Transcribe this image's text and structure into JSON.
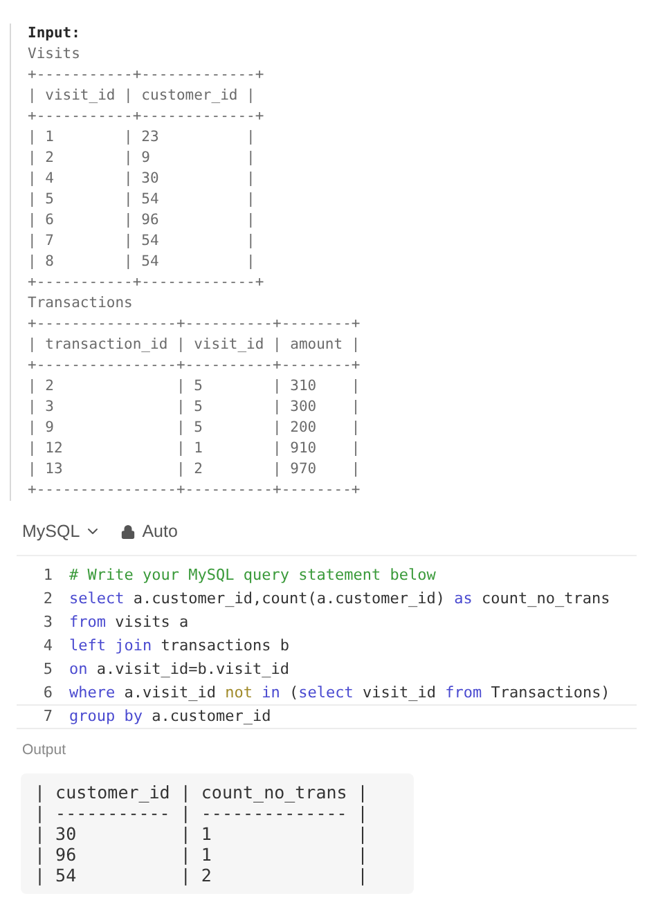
{
  "input_block": {
    "lines": [
      {
        "kind": "label",
        "text": "Input:"
      },
      {
        "kind": "text",
        "text": "Visits"
      },
      {
        "kind": "text",
        "text": "+-----------+-------------+"
      },
      {
        "kind": "text",
        "text": "| visit_id | customer_id |"
      },
      {
        "kind": "text",
        "text": "+-----------+-------------+"
      },
      {
        "kind": "text",
        "text": "| 1        | 23          |"
      },
      {
        "kind": "text",
        "text": "| 2        | 9           |"
      },
      {
        "kind": "text",
        "text": "| 4        | 30          |"
      },
      {
        "kind": "text",
        "text": "| 5        | 54          |"
      },
      {
        "kind": "text",
        "text": "| 6        | 96          |"
      },
      {
        "kind": "text",
        "text": "| 7        | 54          |"
      },
      {
        "kind": "text",
        "text": "| 8        | 54          |"
      },
      {
        "kind": "text",
        "text": "+-----------+-------------+"
      },
      {
        "kind": "text",
        "text": "Transactions"
      },
      {
        "kind": "text",
        "text": "+----------------+----------+--------+"
      },
      {
        "kind": "text",
        "text": "| transaction_id | visit_id | amount |"
      },
      {
        "kind": "text",
        "text": "+----------------+----------+--------+"
      },
      {
        "kind": "text",
        "text": "| 2              | 5        | 310    |"
      },
      {
        "kind": "text",
        "text": "| 3              | 5        | 300    |"
      },
      {
        "kind": "text",
        "text": "| 9              | 5        | 200    |"
      },
      {
        "kind": "text",
        "text": "| 12             | 1        | 910    |"
      },
      {
        "kind": "text",
        "text": "| 13             | 2        | 970    |"
      },
      {
        "kind": "text",
        "text": "+----------------+----------+--------+"
      }
    ]
  },
  "editor_toolbar": {
    "language": "MySQL",
    "mode": "Auto"
  },
  "code_lines": [
    {
      "number": "1",
      "tokens": [
        {
          "kind": "comment",
          "text": "# Write your MySQL query statement below"
        }
      ]
    },
    {
      "number": "2",
      "tokens": [
        {
          "kind": "keyword",
          "text": "select"
        },
        {
          "kind": "plain",
          "text": " a.customer_id,count(a.customer_id) "
        },
        {
          "kind": "keyword",
          "text": "as"
        },
        {
          "kind": "plain",
          "text": " count_no_trans"
        }
      ]
    },
    {
      "number": "3",
      "tokens": [
        {
          "kind": "keyword",
          "text": "from"
        },
        {
          "kind": "plain",
          "text": " visits a"
        }
      ]
    },
    {
      "number": "4",
      "tokens": [
        {
          "kind": "keyword",
          "text": "left join"
        },
        {
          "kind": "plain",
          "text": " transactions b"
        }
      ]
    },
    {
      "number": "5",
      "tokens": [
        {
          "kind": "keyword",
          "text": "on"
        },
        {
          "kind": "plain",
          "text": " a.visit_id=b.visit_id"
        }
      ]
    },
    {
      "number": "6",
      "tokens": [
        {
          "kind": "keyword",
          "text": "where"
        },
        {
          "kind": "plain",
          "text": " a.visit_id "
        },
        {
          "kind": "operator",
          "text": "not"
        },
        {
          "kind": "keyword",
          "text": " in"
        },
        {
          "kind": "plain",
          "text": " ("
        },
        {
          "kind": "keyword",
          "text": "select"
        },
        {
          "kind": "plain",
          "text": " visit_id "
        },
        {
          "kind": "keyword",
          "text": "from"
        },
        {
          "kind": "plain",
          "text": " Transactions)"
        }
      ]
    },
    {
      "number": "7",
      "tokens": [
        {
          "kind": "keyword",
          "text": "group by"
        },
        {
          "kind": "plain",
          "text": " a.customer_id"
        }
      ]
    }
  ],
  "output": {
    "label": "Output",
    "lines": [
      "| customer_id | count_no_trans |",
      "| ----------- | -------------- |",
      "| 30          | 1              |",
      "| 96          | 1              |",
      "| 54          | 2              |"
    ]
  }
}
